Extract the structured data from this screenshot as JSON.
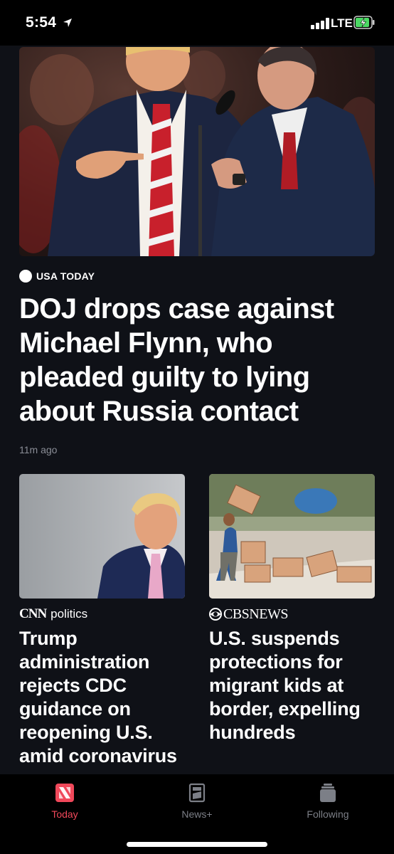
{
  "status_bar": {
    "time": "5:54",
    "network": "LTE",
    "icons": [
      "location-arrow-icon",
      "signal-icon",
      "battery-charging-icon"
    ]
  },
  "hero": {
    "source": "USA TODAY",
    "headline": "DOJ drops case against Michael Flynn, who pleaded guilty to lying about Russia contact",
    "time": "11m ago"
  },
  "cards": [
    {
      "source_logo": "CNN",
      "source_section": "politics",
      "headline": "Trump administration rejects CDC guidance on reopening U.S. amid coronavirus"
    },
    {
      "source_logo": "CBSNEWS",
      "headline": "U.S. suspends protections for migrant kids at border, expelling hundreds"
    }
  ],
  "tabs": [
    {
      "label": "Today",
      "icon": "news-today-icon",
      "active": true
    },
    {
      "label": "News+",
      "icon": "news-plus-icon",
      "active": false
    },
    {
      "label": "Following",
      "icon": "following-icon",
      "active": false
    }
  ],
  "colors": {
    "accent": "#f0485a",
    "feed_background": "#0f1117",
    "secondary_text": "#8a8d96"
  }
}
